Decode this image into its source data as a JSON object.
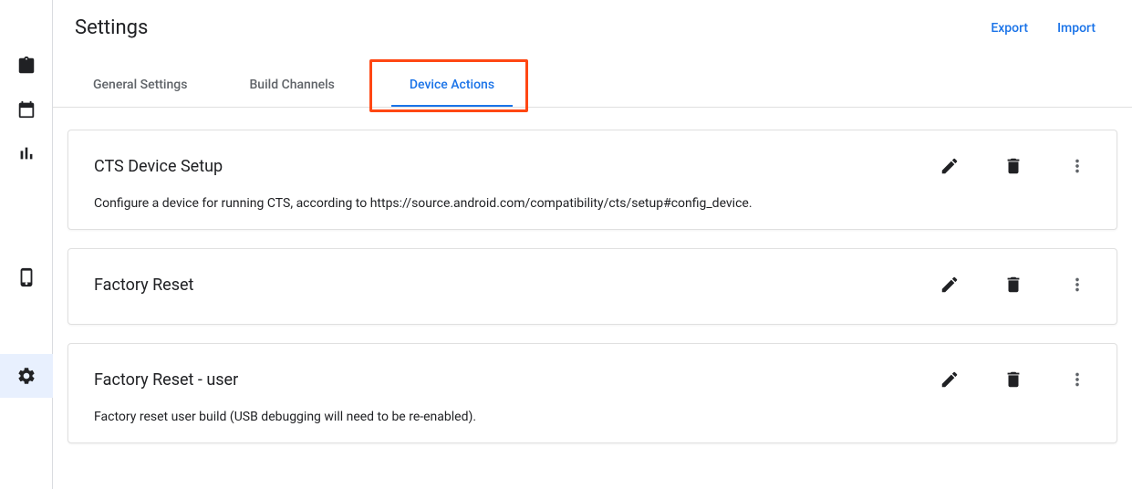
{
  "header": {
    "title": "Settings",
    "export": "Export",
    "import": "Import"
  },
  "tabs": {
    "general": "General Settings",
    "build": "Build Channels",
    "device": "Device Actions"
  },
  "cards": {
    "0": {
      "title": "CTS Device Setup",
      "desc": "Configure a device for running CTS, according to https://source.android.com/compatibility/cts/setup#config_device."
    },
    "1": {
      "title": "Factory Reset",
      "desc": ""
    },
    "2": {
      "title": "Factory Reset - user",
      "desc": "Factory reset user build (USB debugging will need to be re-enabled)."
    }
  }
}
